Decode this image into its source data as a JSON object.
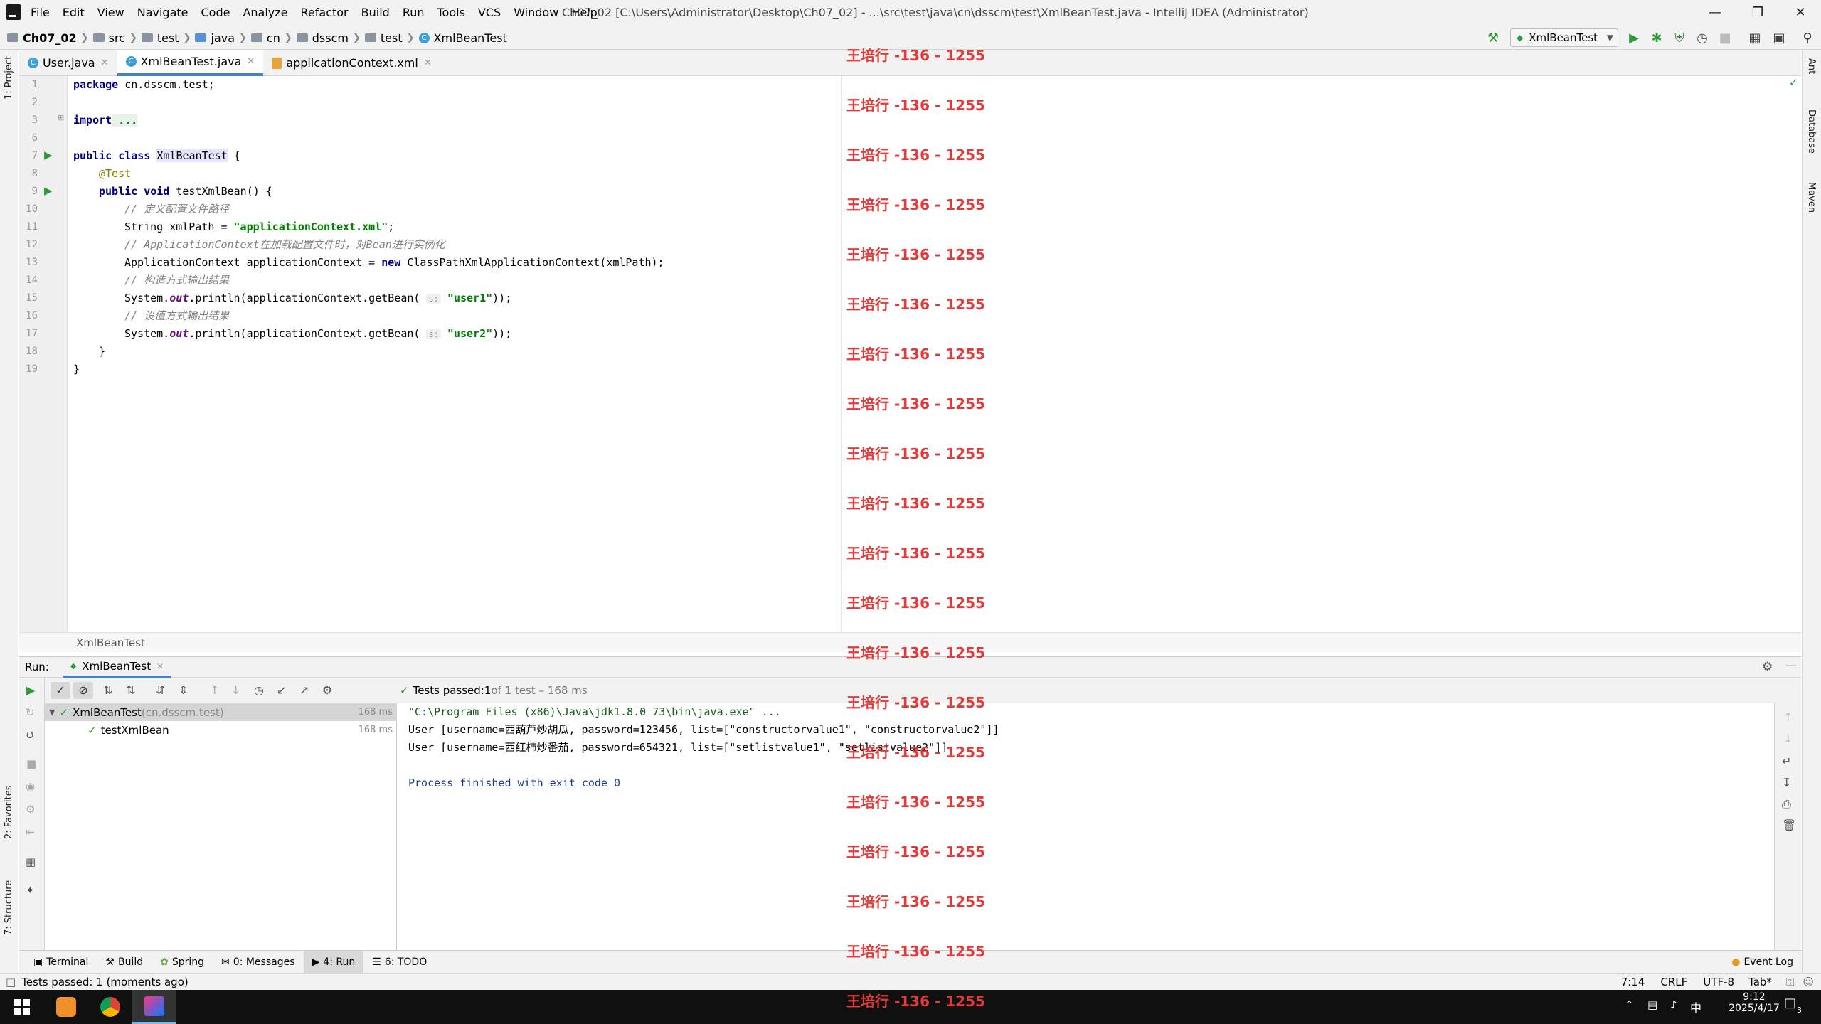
{
  "titlebar": {
    "menu": [
      "File",
      "Edit",
      "View",
      "Navigate",
      "Code",
      "Analyze",
      "Refactor",
      "Build",
      "Run",
      "Tools",
      "VCS",
      "Window",
      "Help"
    ],
    "window_title": "Ch07_02 [C:\\Users\\Administrator\\Desktop\\Ch07_02] - ...\\src\\test\\java\\cn\\dsscm\\test\\XmlBeanTest.java - IntelliJ IDEA (Administrator)"
  },
  "navbar": {
    "crumbs": [
      "Ch07_02",
      "src",
      "test",
      "java",
      "cn",
      "dsscm",
      "test",
      "XmlBeanTest"
    ],
    "run_config": "XmlBeanTest"
  },
  "left_stripe": {
    "project": "1: Project",
    "favorites": "2: Favorites",
    "structure": "7: Structure"
  },
  "right_stripe": {
    "ant": "Ant",
    "database": "Database",
    "maven": "Maven"
  },
  "editor_tabs": [
    {
      "label": "User.java",
      "active": false
    },
    {
      "label": "XmlBeanTest.java",
      "active": true
    },
    {
      "label": "applicationContext.xml",
      "active": false
    }
  ],
  "editor": {
    "line_numbers": [
      "1",
      "2",
      "3",
      "6",
      "7",
      "8",
      "9",
      "10",
      "11",
      "12",
      "13",
      "14",
      "15",
      "16",
      "17",
      "18",
      "19"
    ],
    "lines": {
      "l1_kw": "package",
      "l1_rest": " cn.dsscm.test;",
      "l3_kw": "import",
      "l3_fold": " ...",
      "l7_kw": "public class",
      "l7_sel": "XmlBeanTest",
      "l7_rest": " {",
      "l8_ann": "@Test",
      "l9_kw": "public void",
      "l9_rest": " testXmlBean() {",
      "l10_cmt": "// 定义配置文件路径",
      "l11_a": "String xmlPath = ",
      "l11_str": "\"applicationContext.xml\"",
      "l11_b": ";",
      "l12_cmt": "// ApplicationContext在加载配置文件时，对Bean进行实例化",
      "l13_a": "ApplicationContext applicationContext = ",
      "l13_kw": "new",
      "l13_b": " ClassPathXmlApplicationContext(xmlPath);",
      "l14_cmt": "// 构造方式输出结果",
      "l15_a": "System.",
      "l15_fld": "out",
      "l15_b": ".println(applicationContext.getBean( ",
      "l15_hint": "s:",
      "l15_str": " \"user1\"",
      "l15_c": "));",
      "l16_cmt": "// 设值方式输出结果",
      "l17_a": "System.",
      "l17_fld": "out",
      "l17_b": ".println(applicationContext.getBean( ",
      "l17_hint": "s:",
      "l17_str": " \"user2\"",
      "l17_c": "));",
      "l18": "}",
      "l19": "}"
    },
    "breadcrumb": "XmlBeanTest"
  },
  "run_panel": {
    "label": "Run:",
    "tab": "XmlBeanTest",
    "status_prefix": "Tests passed: ",
    "status_count": "1",
    "status_suffix": " of 1 test – 168 ms",
    "tree": [
      {
        "name": "XmlBeanTest",
        "pkg": " (cn.dsscm.test)",
        "time": "168 ms"
      },
      {
        "name": "testXmlBean",
        "pkg": "",
        "time": "168 ms"
      }
    ],
    "console": [
      "\"C:\\Program Files (x86)\\Java\\jdk1.8.0_73\\bin\\java.exe\" ...",
      "User [username=西葫芦炒胡瓜, password=123456, list=[\"constructorvalue1\", \"constructorvalue2\"]]",
      "User [username=西红柿炒番茄, password=654321, list=[\"setlistvalue1\", \"setlistvalue2\"]]",
      "",
      "Process finished with exit code 0"
    ]
  },
  "tool_tabs": [
    "Terminal",
    "Build",
    "Spring",
    "0: Messages",
    "4: Run",
    "6: TODO"
  ],
  "event_log": "Event Log",
  "status": {
    "message": "Tests passed: 1 (moments ago)",
    "position": "7:14",
    "line_sep": "CRLF",
    "encoding": "UTF-8",
    "indent": "Tab*"
  },
  "taskbar": {
    "ime": "中",
    "time": "9:12",
    "date": "2025/4/17",
    "notifications": "3"
  },
  "watermark": "王培行 -136 - 1255",
  "colors": {
    "accent": "#4083c9",
    "keyword": "#000080",
    "string": "#008000",
    "comment": "#808080",
    "pass": "#2e9b3a",
    "watermark": "#e03a3a"
  }
}
